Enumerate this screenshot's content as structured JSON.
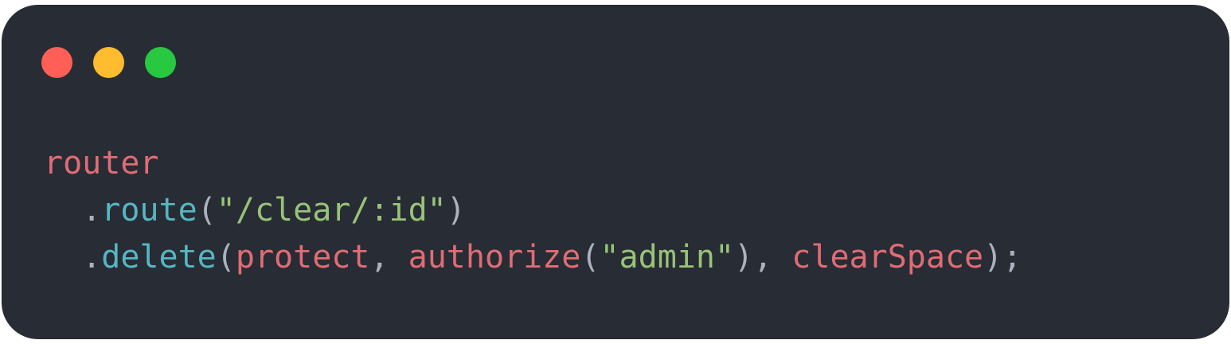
{
  "window": {
    "background": "#282c34",
    "buttons": [
      {
        "name": "close",
        "color": "#ff5f57"
      },
      {
        "name": "minimize",
        "color": "#febc2e"
      },
      {
        "name": "maximize",
        "color": "#28c840"
      }
    ]
  },
  "colors": {
    "identifier": "#e06c75",
    "method": "#56b6c2",
    "string": "#98c379",
    "punctuation": "#abb2bf"
  },
  "code": {
    "line1": {
      "identifier": "router"
    },
    "line2": {
      "indent": "  ",
      "dot": ".",
      "method": "route",
      "open": "(",
      "arg": "\"/clear/:id\"",
      "close": ")"
    },
    "line3": {
      "indent": "  ",
      "dot": ".",
      "method": "delete",
      "open": "(",
      "arg1": "protect",
      "comma1": ", ",
      "fn": "authorize",
      "open2": "(",
      "arg2": "\"admin\"",
      "close2": ")",
      "comma2": ", ",
      "arg3": "clearSpace",
      "close": ");"
    }
  }
}
